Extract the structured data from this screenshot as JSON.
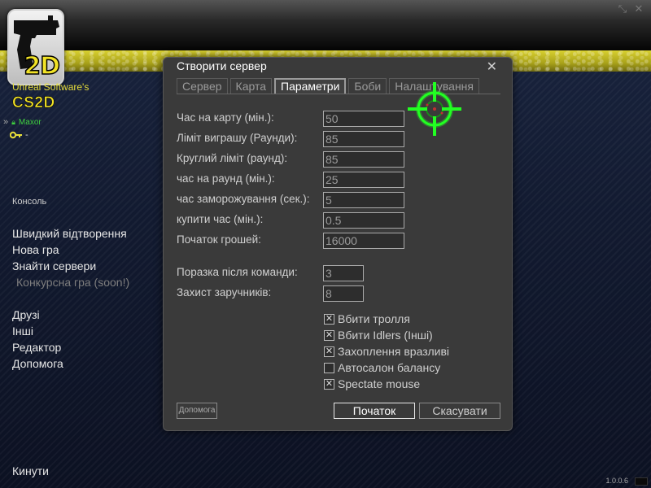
{
  "app": {
    "brand_small": "Unreal Software's",
    "brand_big": "CS2D",
    "logo_text": "2D",
    "version": "1.0.0.6"
  },
  "user": {
    "name": "Maxor",
    "key_value": "-"
  },
  "menu": {
    "console": "Консоль",
    "quick_play": "Швидкий відтворення",
    "new_game": "Нова гра",
    "find_servers": "Знайти сервери",
    "ranked": "Конкурсна гра (soon!)",
    "friends": "Друзі",
    "others": "Інші",
    "editor": "Редактор",
    "help": "Допомога",
    "quit": "Кинути"
  },
  "dialog": {
    "title": "Створити сервер",
    "tabs": [
      {
        "label": "Сервер",
        "active": false
      },
      {
        "label": "Карта",
        "active": false
      },
      {
        "label": "Параметри",
        "active": true
      },
      {
        "label": "Боби",
        "active": false
      },
      {
        "label": "Налаштування",
        "active": false
      }
    ],
    "fields": [
      {
        "label": "Час на карту (мін.):",
        "value": "50"
      },
      {
        "label": "Ліміт виграшу (Раунди):",
        "value": "85"
      },
      {
        "label": "Круглий ліміт (раунд):",
        "value": "85"
      },
      {
        "label": "час на раунд (мін.):",
        "value": "25"
      },
      {
        "label": "час заморожування (сек.):",
        "value": "5"
      },
      {
        "label": "купити час (мін.):",
        "value": "0.5"
      },
      {
        "label": "Початок грошей:",
        "value": "16000"
      },
      {
        "label": "Поразка після команди:",
        "value": "3"
      },
      {
        "label": "Захист заручників:",
        "value": "8"
      }
    ],
    "checkboxes": [
      {
        "label": "Вбити тролля",
        "checked": true
      },
      {
        "label": "Вбити Idlers (Інші)",
        "checked": true
      },
      {
        "label": "Захоплення вразливі",
        "checked": true
      },
      {
        "label": "Автосалон балансу",
        "checked": false
      },
      {
        "label": "Spectate mouse",
        "checked": true
      }
    ],
    "buttons": {
      "help": "Допомога",
      "start": "Початок",
      "cancel": "Скасувати"
    }
  },
  "colors": {
    "accent_yellow": "#f2e326",
    "online_green": "#3fd13f",
    "crosshair_green": "#22ff22"
  }
}
